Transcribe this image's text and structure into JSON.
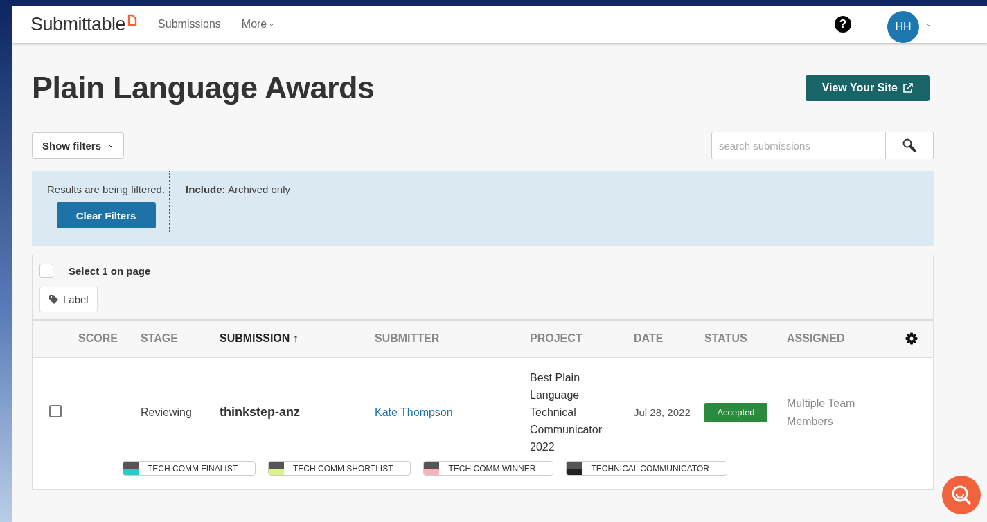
{
  "nav": {
    "logo": "Submittable",
    "links": [
      {
        "label": "Submissions",
        "dropdown": false
      },
      {
        "label": "More",
        "dropdown": true
      }
    ],
    "help": "?",
    "avatar": "HH"
  },
  "page": {
    "title": "Plain Language Awards",
    "view_site": "View Your Site"
  },
  "filters": {
    "toggle": "Show filters",
    "search_placeholder": "search submissions",
    "notice": "Results are being filtered.",
    "clear": "Clear Filters",
    "include_label": "Include:",
    "include_value": "Archived only"
  },
  "bulk": {
    "select_all": "Select 1 on page",
    "checked": false,
    "label_button": "Label"
  },
  "table": {
    "columns": [
      {
        "label": "SCORE",
        "sorted": false
      },
      {
        "label": "STAGE",
        "sorted": false
      },
      {
        "label": "SUBMISSION",
        "sorted": true,
        "arrow": "↑"
      },
      {
        "label": "SUBMITTER",
        "sorted": false
      },
      {
        "label": "PROJECT",
        "sorted": false
      },
      {
        "label": "DATE",
        "sorted": false
      },
      {
        "label": "STATUS",
        "sorted": false
      },
      {
        "label": "ASSIGNED",
        "sorted": false
      }
    ],
    "rows": [
      {
        "checked": false,
        "stage": "Reviewing",
        "submission": "thinkstep-anz",
        "submitter": "Kate Thompson",
        "project": "Best Plain Language Technical Communicator 2022",
        "date": "Jul 28, 2022",
        "status": "Accepted",
        "assigned": "Multiple Team Members",
        "labels": [
          {
            "text": "TECH COMM FINALIST",
            "color": "#2ec9c9"
          },
          {
            "text": "TECH COMM SHORTLIST",
            "color": "#d8f58a"
          },
          {
            "text": "TECH COMM WINNER",
            "color": "#f7b3bb"
          },
          {
            "text": "TECHNICAL COMMUNICATOR",
            "color": "#222222"
          }
        ]
      }
    ]
  }
}
